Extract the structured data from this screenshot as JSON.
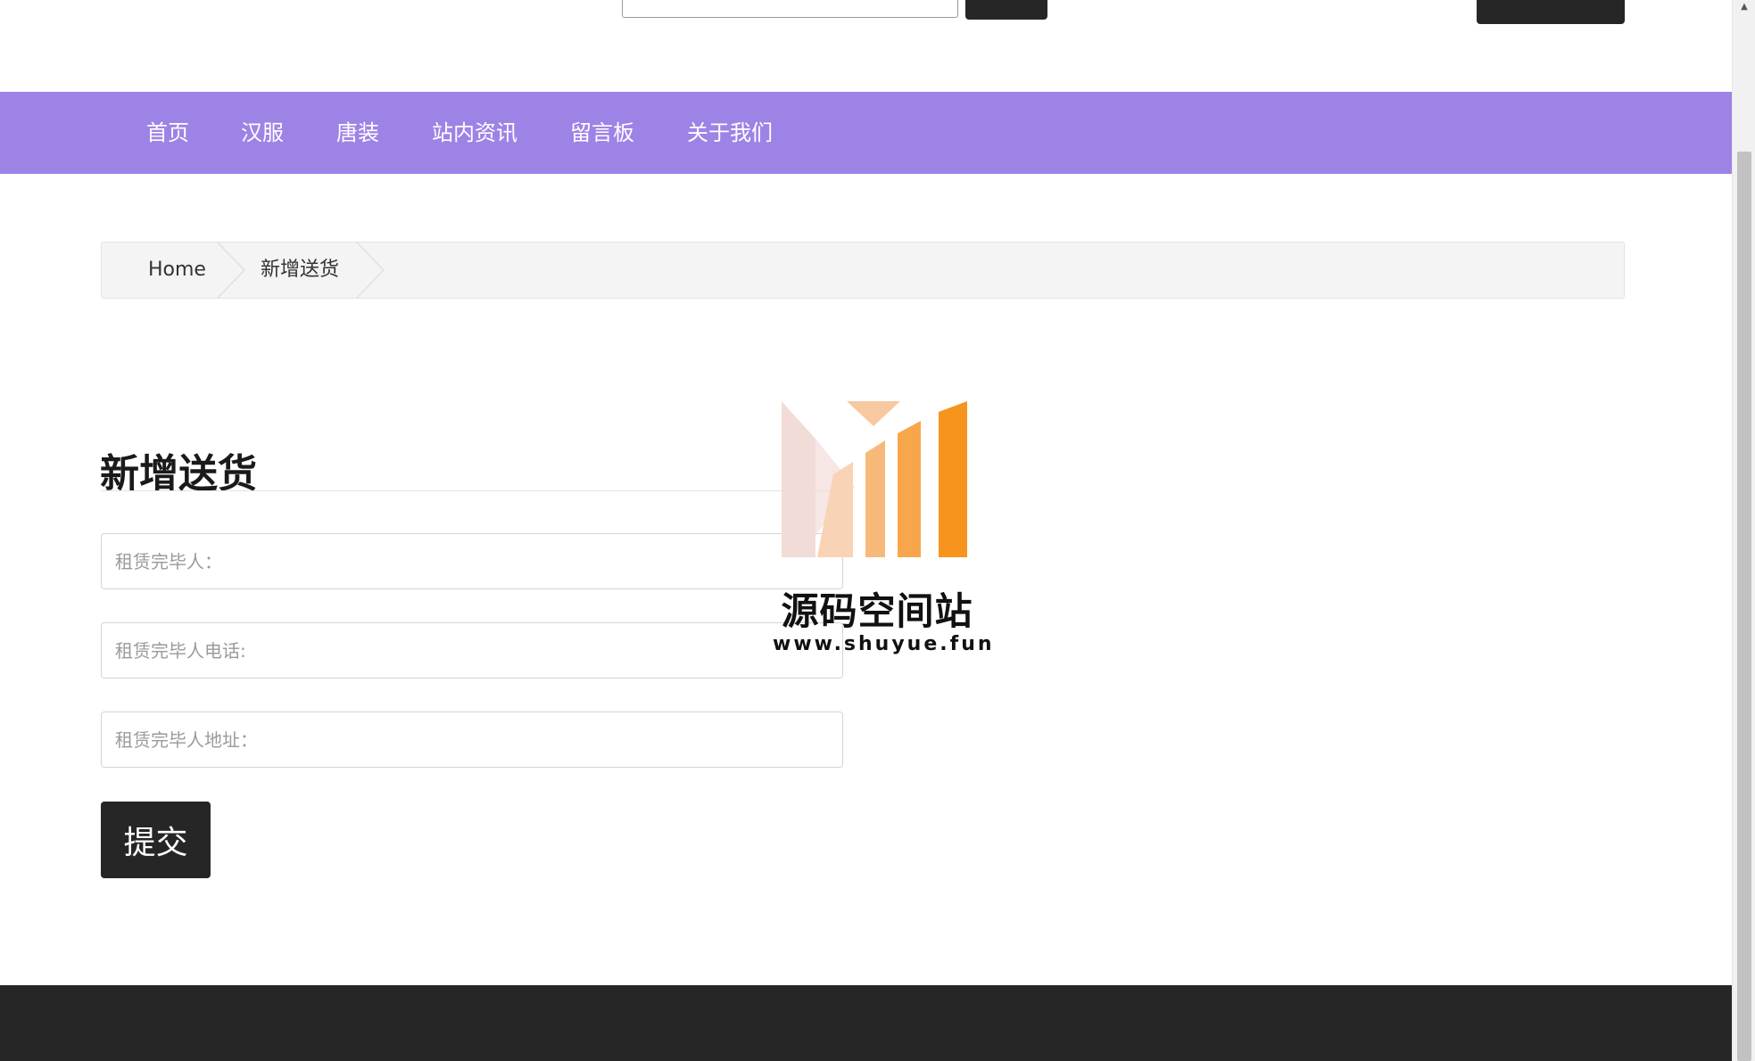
{
  "nav": {
    "items": [
      {
        "label": "首页"
      },
      {
        "label": "汉服"
      },
      {
        "label": "唐装"
      },
      {
        "label": "站内资讯"
      },
      {
        "label": "留言板"
      },
      {
        "label": "关于我们"
      }
    ]
  },
  "breadcrumb": {
    "home": "Home",
    "current": "新增送货"
  },
  "form": {
    "title": "新增送货",
    "fields": [
      {
        "placeholder": "租赁完毕人：",
        "value": ""
      },
      {
        "placeholder": "租赁完毕人电话:",
        "value": ""
      },
      {
        "placeholder": "租赁完毕人地址：",
        "value": ""
      }
    ],
    "submit_label": "提交"
  },
  "watermark": {
    "title": "源码空间站",
    "url": "www.shuyue.fun"
  },
  "colors": {
    "nav_bg": "#9e83e6",
    "dark": "#262626",
    "accent_orange": "#f7941d"
  }
}
